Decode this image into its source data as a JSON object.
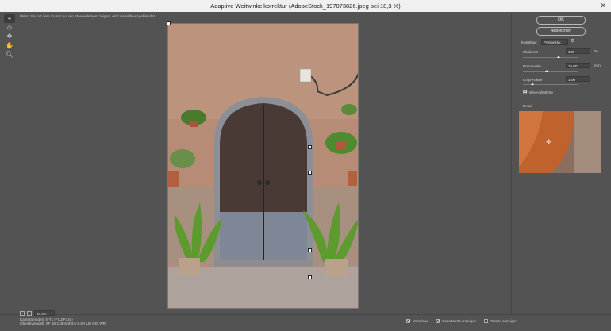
{
  "window": {
    "title": "Adaptive Weitwinkelkorrektur (AdobeStock_197073826.jpeg bei 18,3 %)",
    "close": "✕"
  },
  "tools": [
    {
      "name": "constraint-tool",
      "icon": "constraint-icon",
      "glyph": "⌖"
    },
    {
      "name": "polygon-constraint-tool",
      "icon": "polygon-icon",
      "glyph": "◇"
    },
    {
      "name": "move-tool",
      "icon": "move-icon",
      "glyph": "✥"
    },
    {
      "name": "hand-tool",
      "icon": "hand-icon",
      "glyph": "✋"
    },
    {
      "name": "zoom-tool",
      "icon": "zoom-icon",
      "glyph": "🔍︎"
    }
  ],
  "hint": "Wenn Sie mit dem Cursor auf ein Steuerelement zeigen, wird die Hilfe eingeblendet",
  "panel": {
    "ok_label": "OK",
    "cancel_label": "Abbrechen",
    "correction_label": "Korrektur:",
    "correction_value": "Perspektiv...",
    "scale_label": "Skalieren",
    "scale_value": "100",
    "scale_unit": "%",
    "focal_label": "Brennweite",
    "focal_value": "16,00",
    "focal_unit": "mm",
    "crop_label": "Crop-Faktor",
    "crop_value": "1,00",
    "as_shot_label": "Wie Aufnahme",
    "as_shot_checked": true,
    "detail_label": "Detail"
  },
  "bottom": {
    "zoom_value": "18,3%",
    "camera_model": "Kameramodell: X-T1 (FUJIFILM)",
    "lens_model": "Objektivmodell: XF 18-135mmF3.5-5.6R LM OIS WR",
    "checks": [
      {
        "name": "preview-checkbox",
        "label": "Vorschau",
        "checked": true
      },
      {
        "name": "show-constraints-checkbox",
        "label": "Constraints anzeigen",
        "checked": true
      },
      {
        "name": "show-mesh-checkbox",
        "label": "Raster anzeigen",
        "checked": false
      }
    ]
  }
}
